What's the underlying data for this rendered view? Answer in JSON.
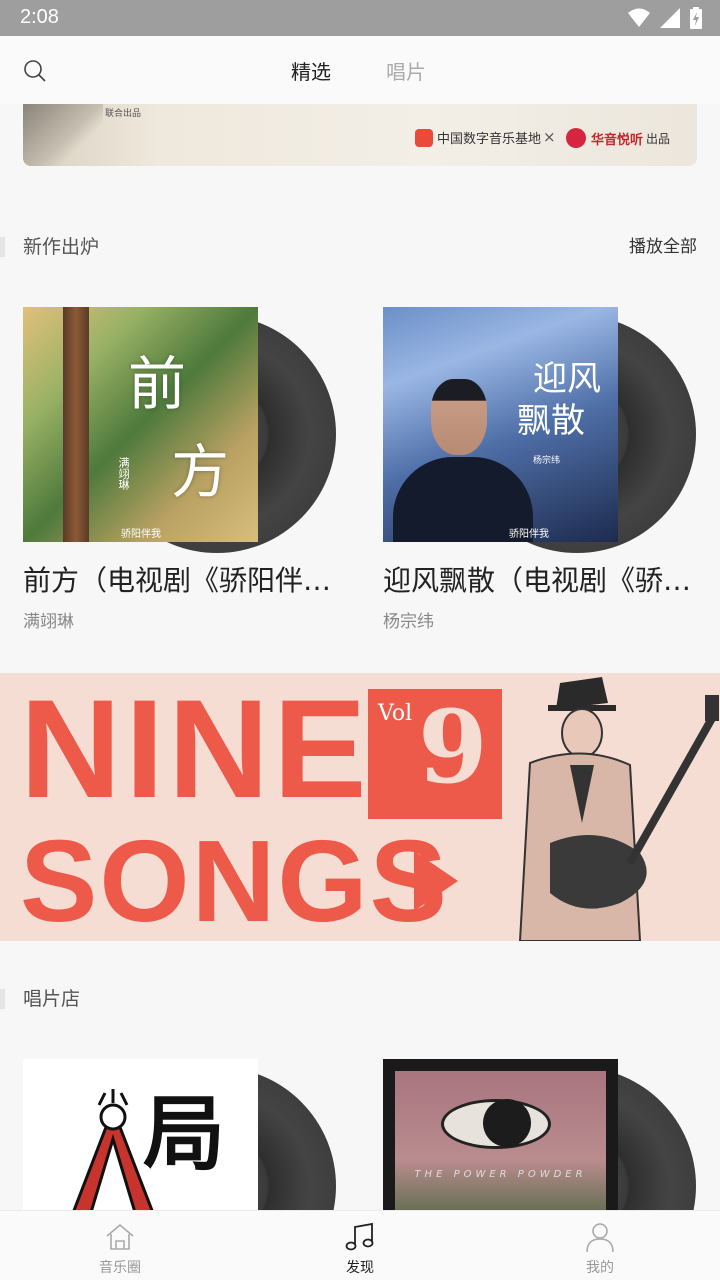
{
  "status_bar": {
    "time": "2:08"
  },
  "header": {
    "tabs": [
      {
        "label": "精选",
        "active": true
      },
      {
        "label": "唱片",
        "active": false
      }
    ]
  },
  "top_banner": {
    "tiny_text": "联合出品",
    "partner1": "中国数字音乐基地",
    "separator": "×",
    "partner2": "华音悦听",
    "suffix": "出品"
  },
  "new_releases": {
    "title": "新作出炉",
    "action": "播放全部",
    "albums": [
      {
        "name": "前方（电视剧《骄阳伴我》插曲）",
        "artist": "满翊琳",
        "cover_text_1": "前",
        "cover_text_2": "方",
        "cover_small": "满翊琳",
        "cover_foot": "骄阳伴我"
      },
      {
        "name": "迎风飘散（电视剧《骄阳伴我》插曲）",
        "artist": "杨宗纬",
        "cover_text_1": "迎风",
        "cover_text_2": "飘散",
        "cover_small": "杨宗纬",
        "cover_foot": "骄阳伴我"
      }
    ]
  },
  "promo_banner": {
    "line1": "NINE",
    "line2": "SONGS",
    "vol": "Vol",
    "number": "9"
  },
  "record_store": {
    "title": "唱片店",
    "albums": [
      {
        "cover_text": "局"
      },
      {
        "cover_text": "THE POWER POWDER"
      }
    ]
  },
  "bottom_nav": [
    {
      "label": "音乐圈",
      "icon": "home-icon",
      "active": false
    },
    {
      "label": "发现",
      "icon": "music-note-icon",
      "active": true
    },
    {
      "label": "我的",
      "icon": "person-icon",
      "active": false
    }
  ],
  "colors": {
    "accent_red": "#ee5a4a",
    "statusbar": "#9e9e9e"
  }
}
